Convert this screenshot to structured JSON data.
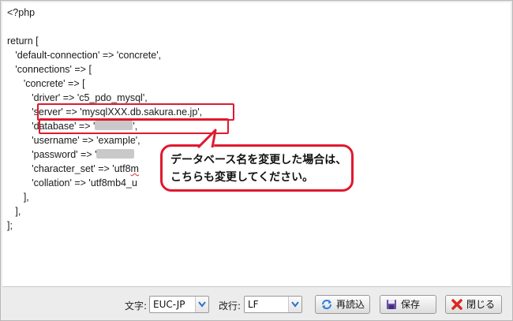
{
  "editor": {
    "lines": [
      "<?php",
      "",
      "return [",
      "   'default-connection' => 'concrete',",
      "   'connections' => [",
      "      'concrete' => [",
      "         'driver' => 'c5_pdo_mysql',",
      "         'server' => 'mysqlXXX.db.sakura.ne.jp',",
      "         'database' => '",
      "         'username' => 'example',",
      "         'password' => '",
      "         'character_set' => 'utf8",
      "         'collation' => 'utf8mb4_u",
      "      ],",
      "   ],",
      "];"
    ],
    "database_suffix": "',",
    "password_suffix": "",
    "charset_squiggle": "m"
  },
  "callout": {
    "line1": "データベース名を変更した場合は、",
    "line2": "こちらも変更してください。"
  },
  "toolbar": {
    "charset_label": "文字:",
    "charset_value": "EUC-JP",
    "newline_label": "改行:",
    "newline_value": "LF",
    "reload_label": "再読込",
    "save_label": "保存",
    "close_label": "閉じる"
  },
  "colors": {
    "highlight": "#e0192d",
    "reload_icon": "#2d7fd8",
    "save_icon": "#6a4fa8",
    "close_icon": "#d92a1e"
  }
}
